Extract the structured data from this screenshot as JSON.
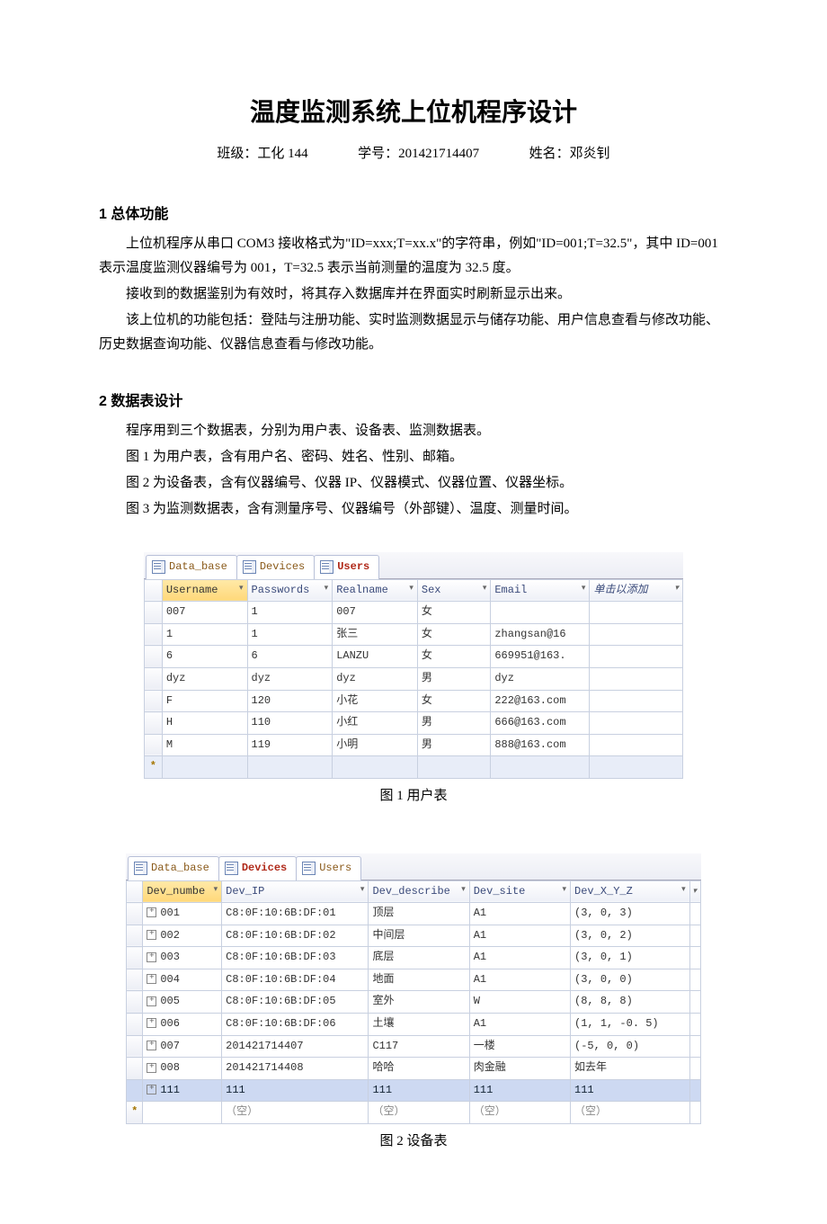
{
  "title": "温度监测系统上位机程序设计",
  "meta": {
    "class_label": "班级：",
    "class_value": "工化 144",
    "id_label": "学号：",
    "id_value": "201421714407",
    "name_label": "姓名：",
    "name_value": "邓炎钊"
  },
  "section1": {
    "heading": "1 总体功能",
    "p1": "上位机程序从串口 COM3 接收格式为\"ID=xxx;T=xx.x\"的字符串，例如\"ID=001;T=32.5\"，其中 ID=001 表示温度监测仪器编号为 001，T=32.5 表示当前测量的温度为 32.5 度。",
    "p2": "接收到的数据鉴别为有效时，将其存入数据库并在界面实时刷新显示出来。",
    "p3": "该上位机的功能包括：登陆与注册功能、实时监测数据显示与储存功能、用户信息查看与修改功能、历史数据查询功能、仪器信息查看与修改功能。"
  },
  "section2": {
    "heading": "2 数据表设计",
    "p1": "程序用到三个数据表，分别为用户表、设备表、监测数据表。",
    "p2": "图 1 为用户表，含有用户名、密码、姓名、性别、邮箱。",
    "p3": "图 2 为设备表，含有仪器编号、仪器 IP、仪器模式、仪器位置、仪器坐标。",
    "p4": "图 3 为监测数据表，含有测量序号、仪器编号（外部键）、温度、测量时间。"
  },
  "captions": {
    "fig1": "图 1  用户表",
    "fig2": "图 2   设备表"
  },
  "tabs": {
    "data_base": "Data_base",
    "devices": "Devices",
    "users": "Users"
  },
  "users_table": {
    "headers": [
      "Username",
      "Passwords",
      "Realname",
      "Sex",
      "Email",
      "单击以添加"
    ],
    "rows": [
      [
        "007",
        "1",
        "007",
        "女",
        "",
        ""
      ],
      [
        "1",
        "1",
        "张三",
        "女",
        "zhangsan@16",
        ""
      ],
      [
        "6",
        "6",
        "LANZU",
        "女",
        "669951@163.",
        ""
      ],
      [
        "dyz",
        "dyz",
        "dyz",
        "男",
        "dyz",
        ""
      ],
      [
        "F",
        "120",
        "小花",
        "女",
        "222@163.com",
        ""
      ],
      [
        "H",
        "110",
        "小红",
        "男",
        "666@163.com",
        ""
      ],
      [
        "M",
        "119",
        "小明",
        "男",
        "888@163.com",
        ""
      ]
    ]
  },
  "devices_table": {
    "headers": [
      "Dev_numbe",
      "Dev_IP",
      "Dev_describe",
      "Dev_site",
      "Dev_X_Y_Z"
    ],
    "rows": [
      [
        "001",
        "C8:0F:10:6B:DF:01",
        "顶层",
        "A1",
        "(3, 0, 3)"
      ],
      [
        "002",
        "C8:0F:10:6B:DF:02",
        "中间层",
        "A1",
        "(3, 0, 2)"
      ],
      [
        "003",
        "C8:0F:10:6B:DF:03",
        "底层",
        "A1",
        "(3, 0, 1)"
      ],
      [
        "004",
        "C8:0F:10:6B:DF:04",
        "地面",
        "A1",
        "(3, 0, 0)"
      ],
      [
        "005",
        "C8:0F:10:6B:DF:05",
        "室外",
        "W",
        "(8, 8, 8)"
      ],
      [
        "006",
        "C8:0F:10:6B:DF:06",
        "土壤",
        "A1",
        "(1, 1, -0. 5)"
      ],
      [
        "007",
        "201421714407",
        "C117",
        "一楼",
        "(-5, 0, 0)"
      ],
      [
        "008",
        "201421714408",
        "哈哈",
        "肉金融",
        "如去年"
      ]
    ],
    "sel_row": [
      "111",
      "111",
      "111",
      "111",
      "111"
    ],
    "new_row_cell": "（空）"
  }
}
